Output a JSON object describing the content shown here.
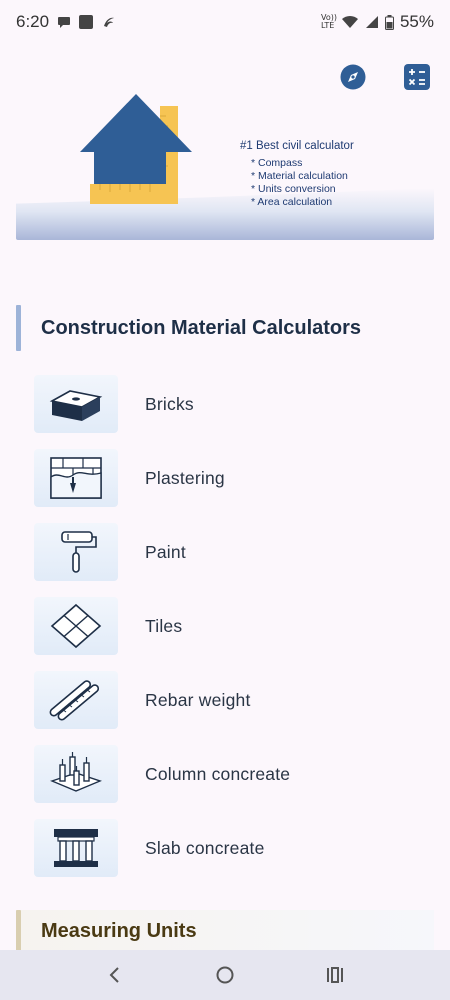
{
  "status_bar": {
    "time": "6:20",
    "network_label": "Vo)) LTE",
    "battery": "55%"
  },
  "top_actions": {
    "compass_icon": "compass-icon",
    "calculator_icon": "calculator-icon"
  },
  "banner": {
    "headline": "#1 Best civil calculator",
    "features": [
      "* Compass",
      "* Material calculation",
      "* Units conversion",
      "* Area calculation"
    ],
    "house_color": "#2f5e96",
    "ruler_color": "#f6c453"
  },
  "sections": {
    "materials_title": "Construction Material Calculators",
    "measuring_title": "Measuring Units"
  },
  "calculators": [
    {
      "label": "Bricks",
      "icon": "brick-icon"
    },
    {
      "label": "Plastering",
      "icon": "plastering-icon"
    },
    {
      "label": "Paint",
      "icon": "paint-roller-icon"
    },
    {
      "label": "Tiles",
      "icon": "tiles-icon"
    },
    {
      "label": "Rebar weight",
      "icon": "rebar-icon"
    },
    {
      "label": "Column concreate",
      "icon": "column-icon"
    },
    {
      "label": "Slab concreate",
      "icon": "slab-icon"
    }
  ],
  "nav": {
    "back_icon": "back-icon",
    "home_icon": "home-icon",
    "recents_icon": "recents-icon"
  }
}
